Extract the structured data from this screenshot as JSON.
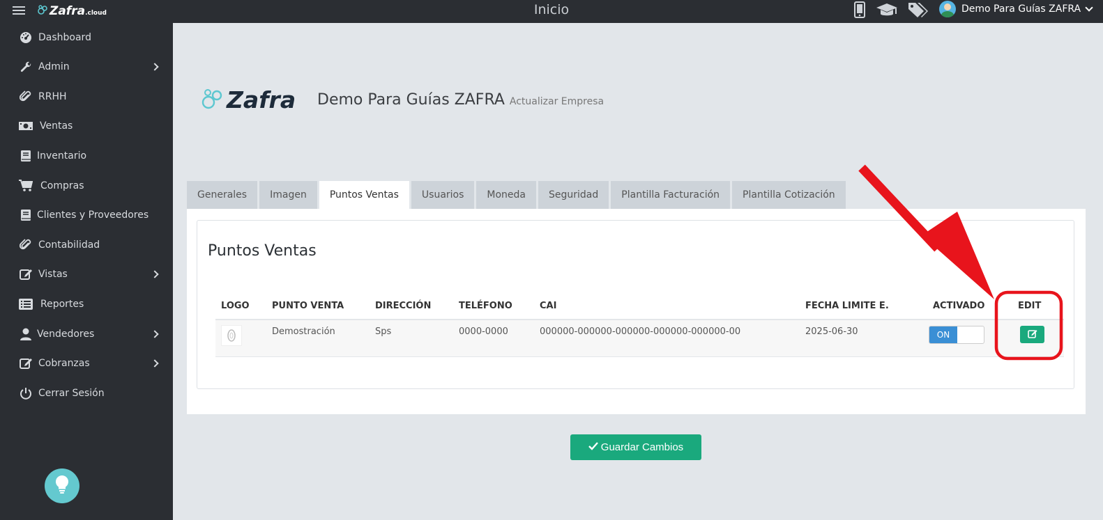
{
  "topbar": {
    "brand_name": "Zafra",
    "brand_suffix": ".cloud",
    "page_title": "Inicio",
    "user_name": "Demo Para Guías ZAFRA"
  },
  "sidebar": {
    "items": [
      {
        "label": "Dashboard",
        "icon": "dashboard-icon",
        "has_arrow": false
      },
      {
        "label": "Admin",
        "icon": "wrench-icon",
        "has_arrow": true
      },
      {
        "label": "RRHH",
        "icon": "paperclip-icon",
        "has_arrow": false
      },
      {
        "label": "Ventas",
        "icon": "money-icon",
        "has_arrow": false
      },
      {
        "label": "Inventario",
        "icon": "book-icon",
        "has_arrow": false
      },
      {
        "label": "Compras",
        "icon": "cart-icon",
        "has_arrow": false
      },
      {
        "label": "Clientes y Proveedores",
        "icon": "book-icon",
        "has_arrow": false
      },
      {
        "label": "Contabilidad",
        "icon": "paperclip-icon",
        "has_arrow": false
      },
      {
        "label": "Vistas",
        "icon": "edit-icon",
        "has_arrow": true
      },
      {
        "label": "Reportes",
        "icon": "list-icon",
        "has_arrow": false
      },
      {
        "label": "Vendedores",
        "icon": "user-icon",
        "has_arrow": true
      },
      {
        "label": "Cobranzas",
        "icon": "edit-icon",
        "has_arrow": true
      },
      {
        "label": "Cerrar Sesión",
        "icon": "power-icon",
        "has_arrow": false
      }
    ]
  },
  "main": {
    "logo_word": "Zafra",
    "company_name": "Demo Para Guías ZAFRA",
    "company_subtitle": "Actualizar Empresa",
    "tabs": [
      {
        "label": "Generales",
        "active": false
      },
      {
        "label": "Imagen",
        "active": false
      },
      {
        "label": "Puntos Ventas",
        "active": true
      },
      {
        "label": "Usuarios",
        "active": false
      },
      {
        "label": "Moneda",
        "active": false
      },
      {
        "label": "Seguridad",
        "active": false
      },
      {
        "label": "Plantilla Facturación",
        "active": false
      },
      {
        "label": "Plantilla Cotización",
        "active": false
      }
    ],
    "section_title": "Puntos Ventas",
    "table": {
      "headers": [
        "LOGO",
        "PUNTO VENTA",
        "DIRECCIÓN",
        "TELÉFONO",
        "CAI",
        "FECHA LIMITE E.",
        "ACTIVADO",
        "EDIT"
      ],
      "rows": [
        {
          "punto_venta": "Demostración",
          "direccion": "Sps",
          "telefono": "0000-0000",
          "cai": "000000-000000-000000-000000-000000-00",
          "fecha_limite": "2025-06-30",
          "activado": "ON"
        }
      ]
    },
    "save_label": "Guardar Cambios"
  },
  "colors": {
    "sidebar_bg": "#2b2e33",
    "accent_green": "#1aa97d",
    "toggle_blue": "#3a8fd5",
    "annotation_red": "#e8141c",
    "brand_teal": "#5cc7d0"
  }
}
